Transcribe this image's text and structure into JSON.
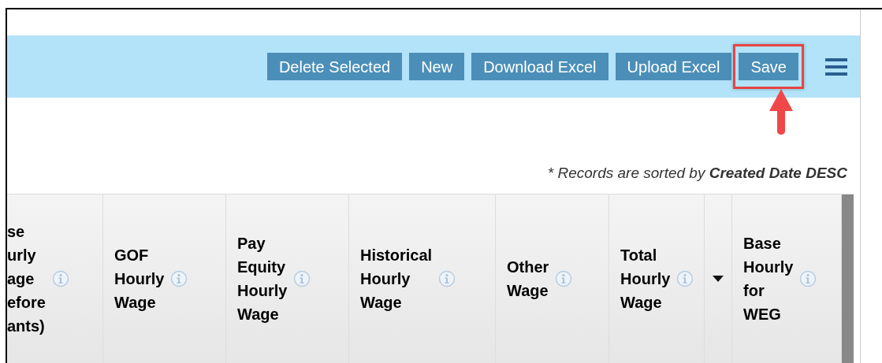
{
  "toolbar": {
    "buttons": [
      {
        "label": "Delete Selected",
        "highlighted": false
      },
      {
        "label": "New",
        "highlighted": false
      },
      {
        "label": "Download Excel",
        "highlighted": false
      },
      {
        "label": "Upload Excel",
        "highlighted": false
      },
      {
        "label": "Save",
        "highlighted": true
      }
    ]
  },
  "sort_note": "* Records are sorted by **Created Date DESC**",
  "table": {
    "columns": [
      {
        "kind": "text",
        "label": "se\nurly\nage\nefore\nants)",
        "info": true
      },
      {
        "kind": "text",
        "label": "GOF\nHourly\nWage",
        "info": true
      },
      {
        "kind": "text",
        "label": "Pay\nEquity\nHourly\nWage",
        "info": true
      },
      {
        "kind": "text",
        "label": "Historical\nHourly\nWage",
        "info": true
      },
      {
        "kind": "text",
        "label": "Other\nWage",
        "info": true
      },
      {
        "kind": "text",
        "label": "Total\nHourly\nWage",
        "info": true
      },
      {
        "kind": "sort"
      },
      {
        "kind": "text",
        "label": "Base\nHourly\nfor\nWEG",
        "info": true
      }
    ]
  }
}
